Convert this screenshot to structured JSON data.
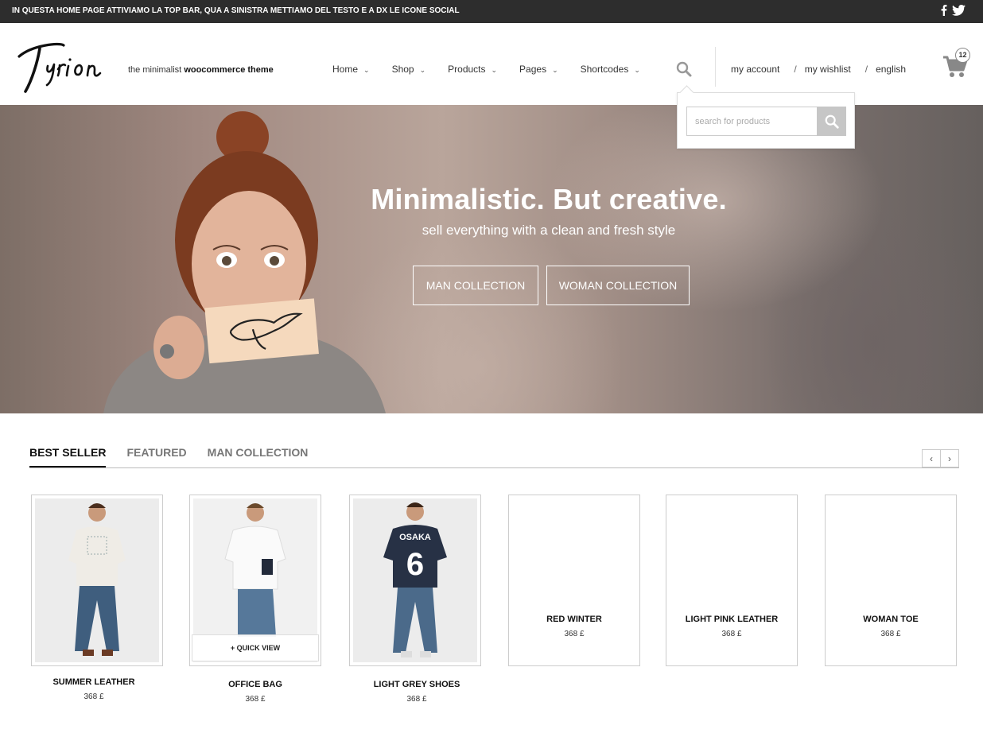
{
  "topbar": {
    "message": "IN QUESTA HOME PAGE ATTIVIAMO LA TOP BAR, QUA A SINISTRA METTIAMO DEL TESTO E A DX LE ICONE SOCIAL",
    "social": [
      "facebook-icon",
      "twitter-icon"
    ]
  },
  "brand": {
    "logo_text": "Tyrion",
    "tagline_prefix": "the minimalist",
    "tagline_bold": "woocommerce theme"
  },
  "nav": {
    "items": [
      {
        "label": "Home"
      },
      {
        "label": "Shop"
      },
      {
        "label": "Products"
      },
      {
        "label": "Pages"
      },
      {
        "label": "Shortcodes"
      }
    ]
  },
  "account": {
    "my_account": "my account",
    "sep": "/",
    "my_wishlist": "my wishlist",
    "language": "english"
  },
  "cart": {
    "count": "12"
  },
  "search": {
    "placeholder": "search for products"
  },
  "hero": {
    "headline_light": "Minimalistic.",
    "headline_bold": "But creative.",
    "subtitle": "sell everything with a clean and fresh style",
    "cta_man": "MAN COLLECTION",
    "cta_woman": "WOMAN COLLECTION"
  },
  "tabs": {
    "items": [
      {
        "label": "BEST SELLER",
        "active": true
      },
      {
        "label": "FEATURED",
        "active": false
      },
      {
        "label": "MAN COLLECTION",
        "active": false
      }
    ],
    "prev_icon": "chevron-left-icon",
    "next_icon": "chevron-right-icon"
  },
  "products": [
    {
      "name": "SUMMER LEATHER",
      "price": "368 £",
      "has_image": true,
      "shirt_color": "#efece6"
    },
    {
      "name": "OFFICE BAG",
      "price": "368 £",
      "has_image": true,
      "shirt_color": "#f7f7f7",
      "quick_view": "+ QUICK VIEW"
    },
    {
      "name": "LIGHT GREY SHOES",
      "price": "368 £",
      "has_image": true,
      "shirt_color": "#273145"
    },
    {
      "name": "RED WINTER",
      "price": "368 £",
      "has_image": false
    },
    {
      "name": "LIGHT PINK LEATHER",
      "price": "368 £",
      "has_image": false
    },
    {
      "name": "WOMAN TOE",
      "price": "368 £",
      "has_image": false
    }
  ],
  "colors": {
    "topbar_bg": "#2d2d2d",
    "text_dark": "#111111",
    "border": "#cccccc"
  }
}
